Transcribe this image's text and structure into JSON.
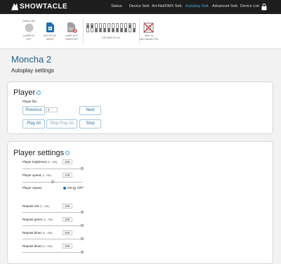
{
  "brand": {
    "name": "SHOWTACLE"
  },
  "nav": {
    "items": [
      {
        "label": "Status"
      },
      {
        "label": "Device Sett."
      },
      {
        "label": "Art-Net/DMX Sett."
      },
      {
        "label": "Autoplay Sett."
      },
      {
        "label": "Advanced Sett."
      },
      {
        "label": "Device List"
      }
    ],
    "active": "Autoplay Sett."
  },
  "statusbar": {
    "title": "Status Bar",
    "laser": {
      "line1": "LASER IS",
      "line2": "OFF"
    },
    "autoplay": {
      "line1": "AUTOPLAY",
      "line2": "MODE"
    },
    "card": {
      "line1": "CARD NOT",
      "line2": "INSERTED"
    },
    "dip": {
      "label": "DIP SWITCH 24"
    },
    "dmx": {
      "line1": "DMX IS",
      "line2": "UNCONNECTED"
    }
  },
  "page": {
    "title": "Moncha 2",
    "subtitle": "Autoplay settings"
  },
  "player": {
    "title": "Player",
    "file_label": "Player file:",
    "file_value": "0",
    "previous": "Previous",
    "next": "Next",
    "play_all": "Play All",
    "stop_play_all": "Stop Play All",
    "stop": "Stop"
  },
  "settings": {
    "title": "Player settings",
    "range": "(0 - 255):",
    "brightness": {
      "label": "Player brightness",
      "value": "255",
      "level": 1.0
    },
    "speed": {
      "label": "Player speed",
      "value": "128",
      "level": 0.5
    },
    "repeat": {
      "label": "Player repeat:",
      "on": "ON",
      "off": "OFF"
    },
    "red": {
      "label": "Repaint red",
      "value": "255",
      "level": 1.0
    },
    "green": {
      "label": "Repaint green",
      "value": "255",
      "level": 1.0
    },
    "blue1": {
      "label": "Repaint blue1",
      "value": "255",
      "level": 1.0
    },
    "blue2": {
      "label": "Repaint blue2",
      "value": "255",
      "level": 1.0
    }
  },
  "colors": {
    "accent": "#1f5f8b",
    "nav_active": "#4aa3e0",
    "topbar": "#1d1d1d"
  }
}
